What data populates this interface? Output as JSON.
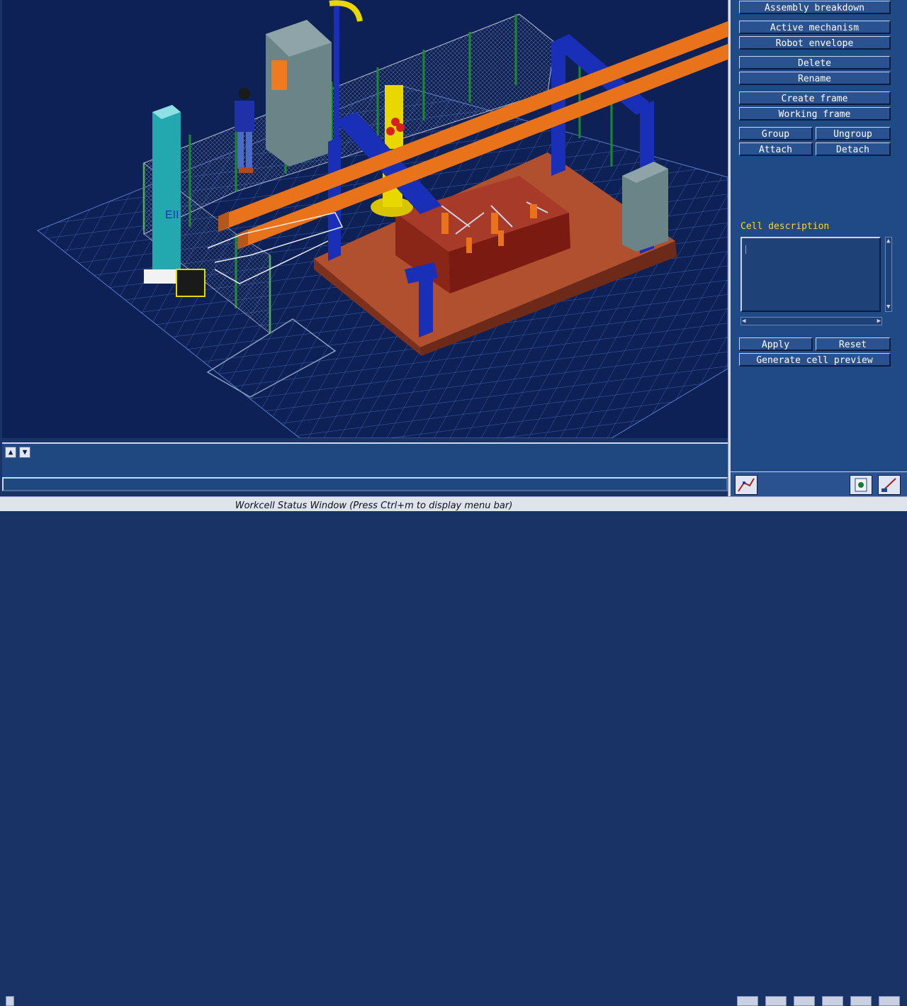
{
  "panel": {
    "buttons": {
      "assembly_breakdown": "Assembly breakdown",
      "active_mechanism": "Active mechanism",
      "robot_envelope": "Robot envelope",
      "delete": "Delete",
      "rename": "Rename",
      "create_frame": "Create frame",
      "working_frame": "Working frame",
      "group": "Group",
      "ungroup": "Ungroup",
      "attach": "Attach",
      "detach": "Detach",
      "apply": "Apply",
      "reset": "Reset",
      "generate_cell_preview": "Generate cell preview"
    },
    "cell_description_label": "Cell description",
    "cell_description_value": ""
  },
  "scene": {
    "column_text": "EII"
  },
  "status_bar": {
    "text": "Workcell Status Window (Press Ctrl+m to display menu bar)"
  },
  "icons": {
    "log_up": "scroll-up-arrow",
    "log_down": "scroll-down-arrow",
    "toolbar": [
      "robot-arm-icon",
      "notepad-icon",
      "drawing-tool-icon"
    ]
  },
  "colors": {
    "panel_bg": "#204a85",
    "viewport_bg": "#0e2157",
    "label_yellow": "#ffd23a",
    "beam_orange": "#e8731a",
    "gantry_blue": "#1a2fb8",
    "platform_red": "#8c3a22"
  }
}
